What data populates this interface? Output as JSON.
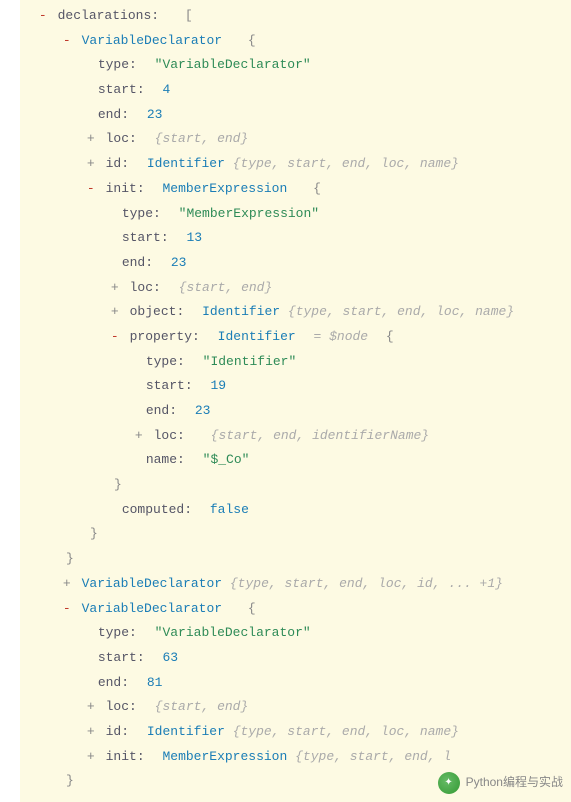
{
  "root": {
    "key": "declarations",
    "bracket": "["
  },
  "d0": {
    "name": "VariableDeclarator",
    "type": "\"VariableDeclarator\"",
    "start": "4",
    "end": "23",
    "loc_preview": "{start, end}",
    "id_name": "Identifier",
    "id_preview": "{type, start, end, loc, name}",
    "init": {
      "name": "MemberExpression",
      "type": "\"MemberExpression\"",
      "start": "13",
      "end": "23",
      "loc_preview": "{start, end}",
      "object_name": "Identifier",
      "object_preview": "{type, start, end, loc, name}",
      "property": {
        "name": "Identifier",
        "tag": "= $node",
        "type": "\"Identifier\"",
        "start": "19",
        "end": "23",
        "loc_preview": "{start, end, identifierName}",
        "name_val": "\"$_Co\""
      },
      "computed": "false"
    }
  },
  "d1": {
    "name": "VariableDeclarator",
    "preview": "{type, start, end, loc, id, ... +1}"
  },
  "d2": {
    "name": "VariableDeclarator",
    "type": "\"VariableDeclarator\"",
    "start": "63",
    "end": "81",
    "loc_preview": "{start, end}",
    "id_name": "Identifier",
    "id_preview": "{type, start, end, loc, name}",
    "init_name": "MemberExpression",
    "init_preview": "{type, start, end, l"
  },
  "labels": {
    "type": "type",
    "start": "start",
    "end": "end",
    "loc": "loc",
    "id": "id",
    "init": "init",
    "object": "object",
    "property": "property",
    "name": "name",
    "computed": "computed"
  },
  "footer": {
    "text": "Python编程与实战"
  }
}
